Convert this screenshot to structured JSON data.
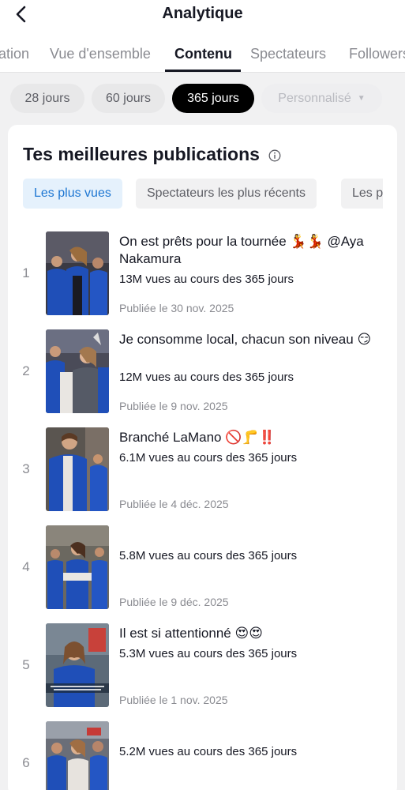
{
  "header": {
    "title": "Analytique"
  },
  "tabs": [
    {
      "label": "ation"
    },
    {
      "label": "Vue d'ensemble"
    },
    {
      "label": "Contenu"
    },
    {
      "label": "Spectateurs"
    },
    {
      "label": "Followers"
    }
  ],
  "period_chips": [
    {
      "label": "28 jours"
    },
    {
      "label": "60 jours"
    },
    {
      "label": "365 jours"
    },
    {
      "label": "Personnalisé"
    }
  ],
  "section": {
    "title": "Tes meilleures publications",
    "filters": [
      {
        "label": "Les plus vues"
      },
      {
        "label": "Spectateurs les plus récents"
      },
      {
        "label": "Les plus"
      }
    ]
  },
  "posts": [
    {
      "rank": "1",
      "title": "On est prêts pour la tournée 💃💃 @Aya Nakamura",
      "views": "13M vues au cours des 365 jours",
      "date": "Publiée le 30 nov. 2025"
    },
    {
      "rank": "2",
      "title": "Je consomme local, chacun son niveau 😏",
      "views": "12M vues au cours des 365 jours",
      "date": "Publiée le 9 nov. 2025"
    },
    {
      "rank": "3",
      "title": "Branché LaMano 🚫🦵‼️",
      "views": "6.1M vues au cours des 365 jours",
      "date": "Publiée le 4 déc. 2025"
    },
    {
      "rank": "4",
      "title": "",
      "views": "5.8M vues au cours des 365 jours",
      "date": "Publiée le 9 déc. 2025"
    },
    {
      "rank": "5",
      "title": "Il est si attentionné 😍😍",
      "views": "5.3M vues au cours des 365 jours",
      "date": "Publiée le 1 nov. 2025"
    },
    {
      "rank": "6",
      "title": "",
      "views": "5.2M vues au cours des 365 jours",
      "date": ""
    }
  ],
  "colors": {
    "accent_blue": "#1d76d2",
    "vest_blue": "#1f4fb8",
    "text": "#161823",
    "muted": "#8a8b91"
  },
  "icons": {
    "back": "chevron-left-icon",
    "info": "info-circle-icon",
    "dropdown": "caret-down-icon"
  }
}
